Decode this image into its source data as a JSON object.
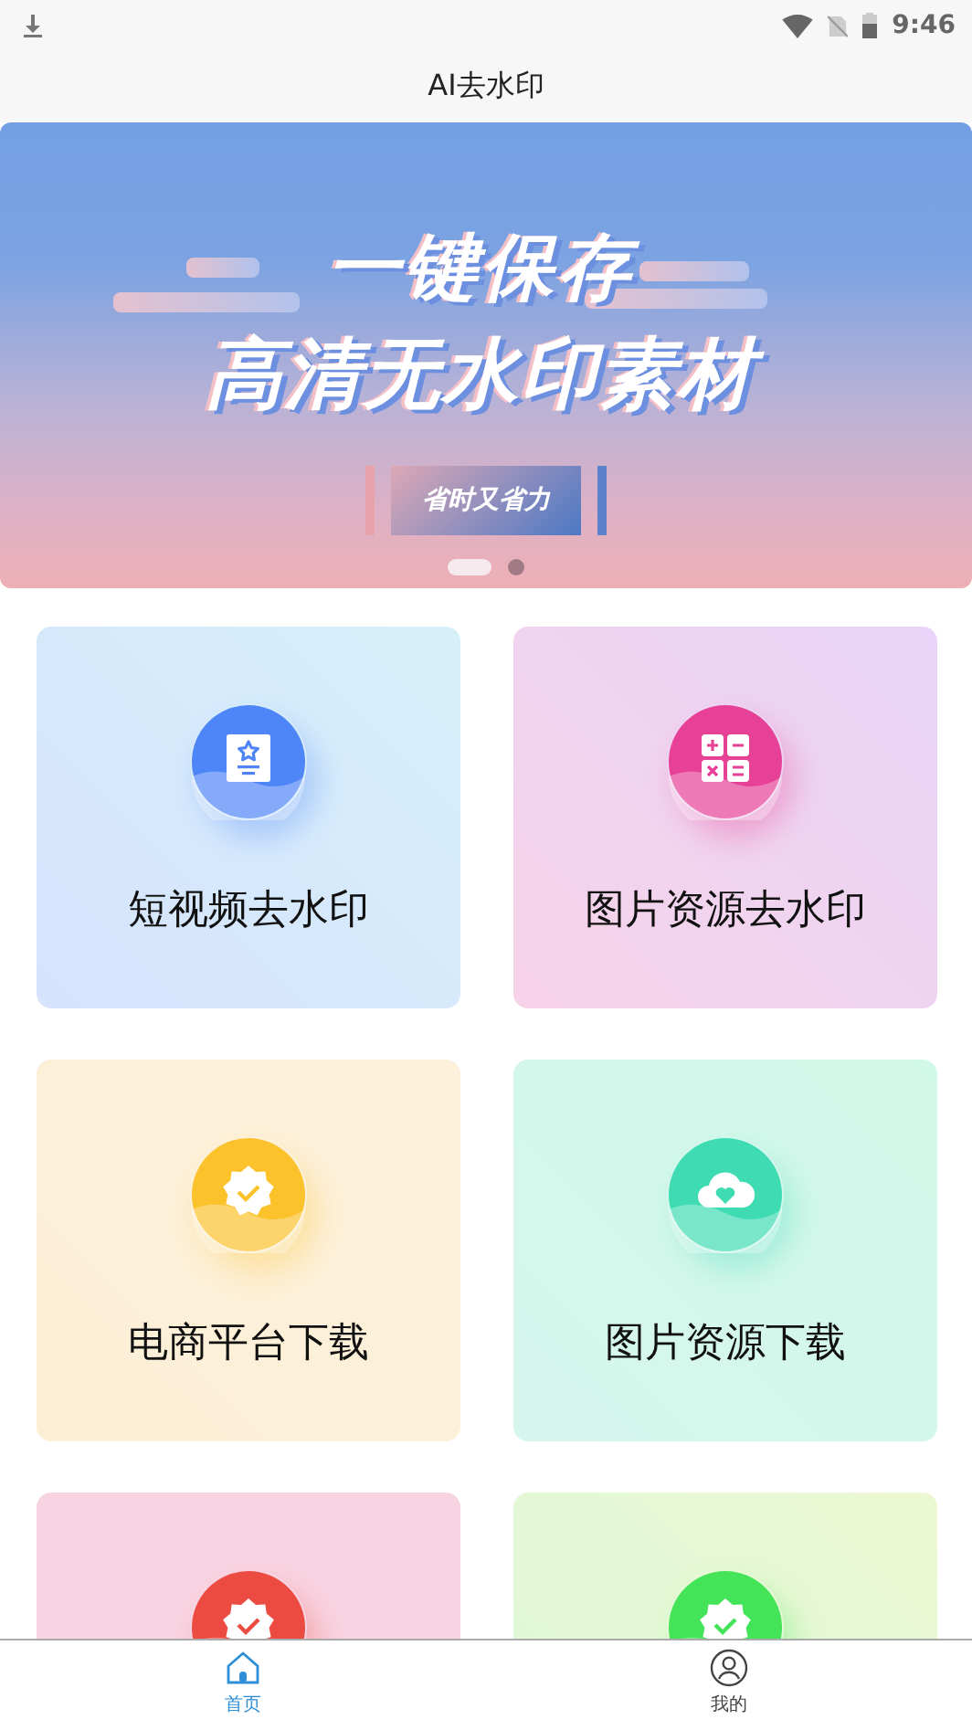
{
  "status_bar": {
    "time": "9:46"
  },
  "title": "AI去水印",
  "banner": {
    "headline": "一键保存",
    "subheadline": "高清无水印素材",
    "tag": "省时又省力",
    "dots": [
      {
        "selected": true
      },
      {
        "selected": false
      }
    ]
  },
  "cards": [
    {
      "kind": "document",
      "color": "#4f86f7",
      "title": "短视频去水印"
    },
    {
      "kind": "calculator",
      "color": "#e64197",
      "title": "图片资源去水印"
    },
    {
      "kind": "badge",
      "color": "#fbc22c",
      "title": "电商平台下载"
    },
    {
      "kind": "cloud",
      "color": "#3fdcb4",
      "title": "图片资源下载"
    },
    {
      "kind": "badge",
      "color": "#ec4b41"
    },
    {
      "kind": "badge",
      "color": "#43e458"
    }
  ],
  "tab_bar": [
    {
      "label": "首页",
      "kind": "home",
      "selected": true
    },
    {
      "label": "我的",
      "kind": "profile",
      "selected": false
    }
  ]
}
